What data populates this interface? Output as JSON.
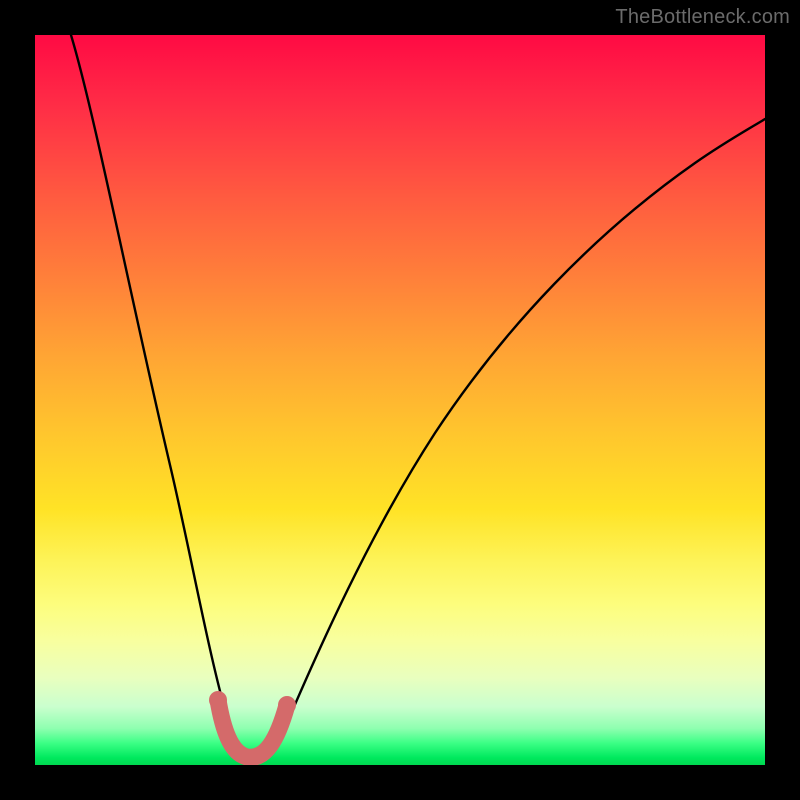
{
  "watermark": "TheBottleneck.com",
  "chart_data": {
    "type": "line",
    "title": "",
    "xlabel": "",
    "ylabel": "",
    "xlim": [
      0,
      100
    ],
    "ylim": [
      0,
      100
    ],
    "grid": false,
    "legend": false,
    "series": [
      {
        "name": "bottleneck-curve",
        "color": "#000000",
        "x": [
          5,
          7,
          9,
          11,
          13,
          15,
          17,
          19,
          21,
          23,
          25,
          26,
          27,
          28,
          29,
          30,
          32,
          34,
          37,
          40,
          44,
          48,
          52,
          56,
          60,
          65,
          70,
          75,
          80,
          85,
          90,
          95,
          100
        ],
        "y": [
          100,
          91,
          82,
          74,
          66,
          58,
          50,
          43,
          35,
          28,
          20,
          15,
          10,
          6,
          3,
          1,
          1,
          3,
          7,
          12,
          18,
          24,
          30,
          36,
          42,
          48,
          54,
          60,
          65,
          70,
          74,
          78,
          82
        ]
      },
      {
        "name": "optimal-marker",
        "color": "#d46a6a",
        "x": [
          25,
          26.5,
          28,
          29.5,
          31,
          32.5,
          34
        ],
        "y": [
          9,
          4,
          1,
          0.5,
          1,
          4,
          9
        ]
      }
    ],
    "background_gradient": {
      "top": "#ff0a44",
      "mid": "#ffe326",
      "bottom": "#00d850"
    }
  }
}
